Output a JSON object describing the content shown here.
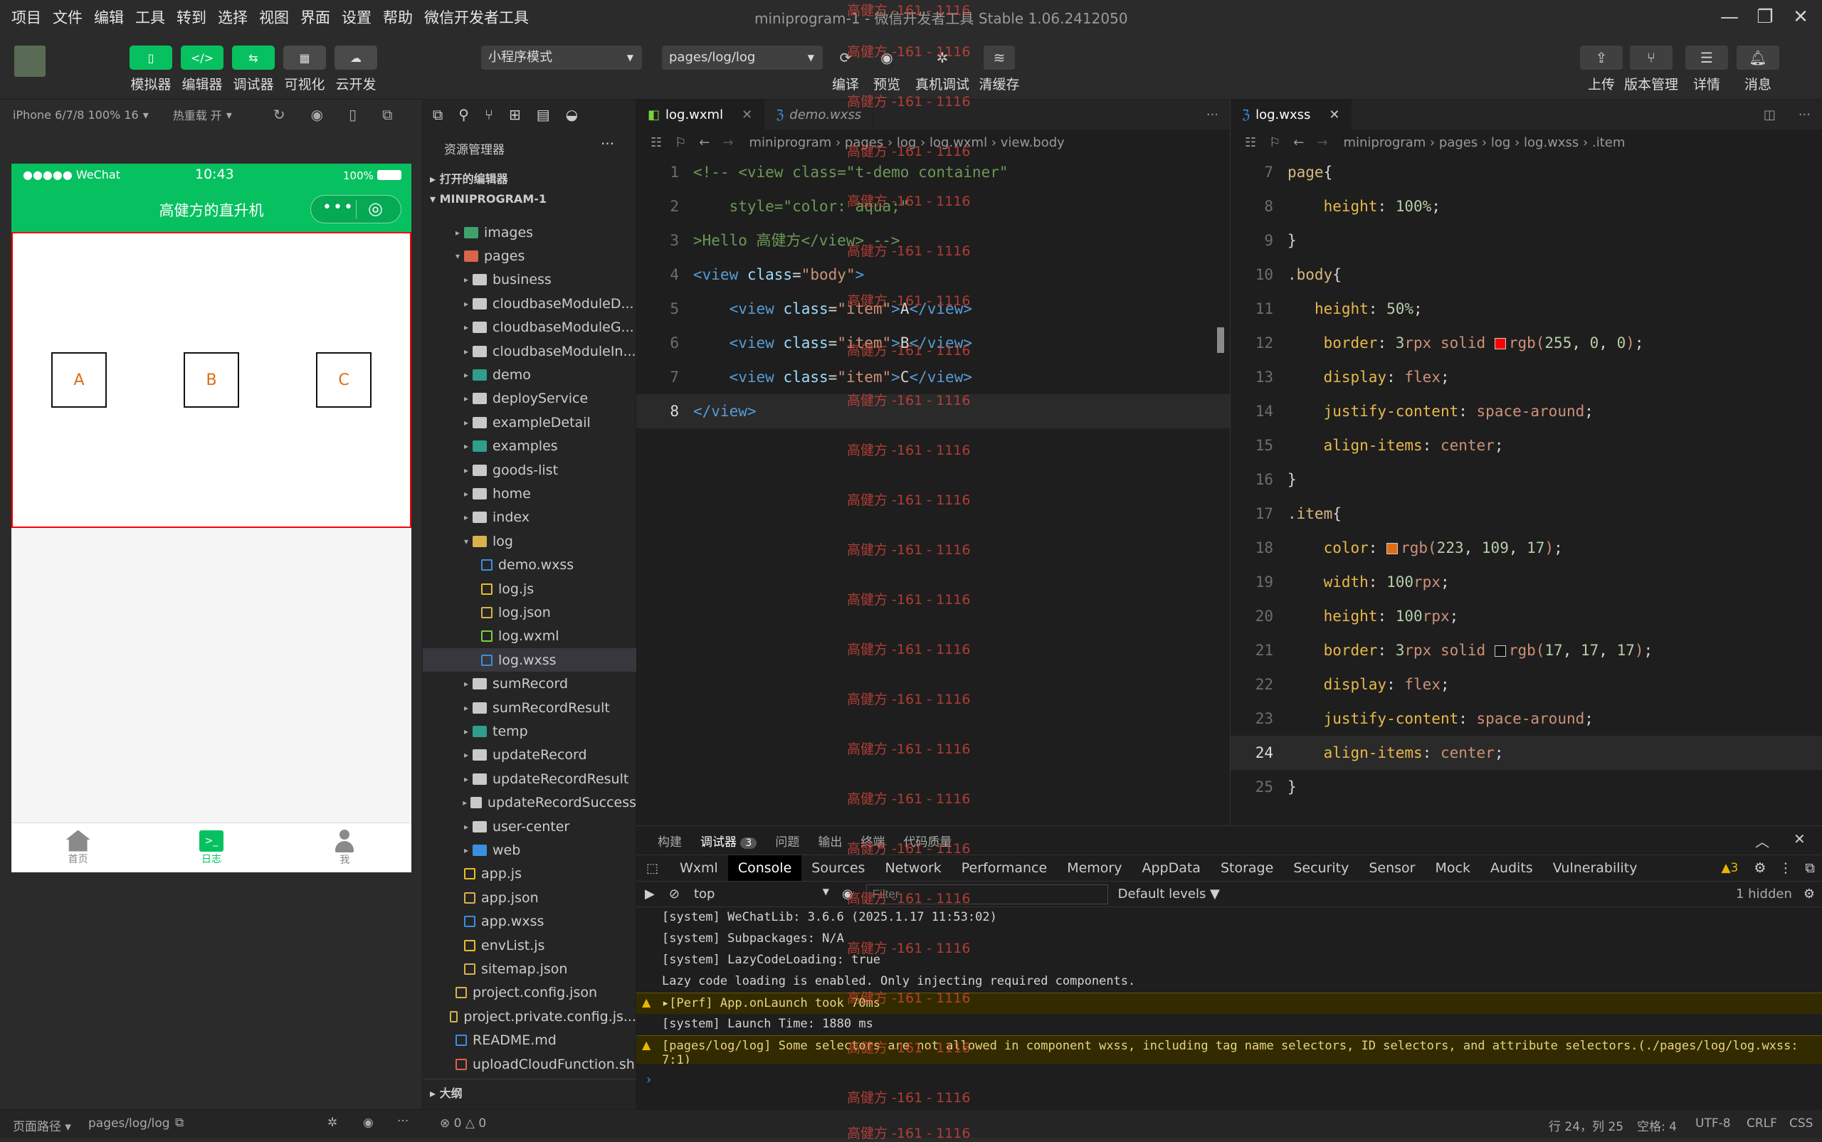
{
  "menubar": {
    "items": [
      "项目",
      "文件",
      "编辑",
      "工具",
      "转到",
      "选择",
      "视图",
      "界面",
      "设置",
      "帮助",
      "微信开发者工具"
    ],
    "title": "miniprogram-1 - 微信开发者工具 Stable 1.06.2412050"
  },
  "toolbar": {
    "simulator": "模拟器",
    "editor": "编辑器",
    "debugger": "调试器",
    "visual": "可视化",
    "cloud": "云开发",
    "mode": "小程序模式",
    "page_path": "pages/log/log",
    "compile": "编译",
    "preview": "预览",
    "real_debug": "真机调试",
    "clear_cache": "清缓存",
    "upload": "上传",
    "version": "版本管理",
    "details": "详情",
    "messages": "消息"
  },
  "simulator": {
    "device": "iPhone 6/7/8 100% 16",
    "hot_reload": "热重载 开",
    "status_carrier": "●●●●● WeChat",
    "status_time": "10:43",
    "status_battery": "100%",
    "nav_title": "高健方的直升机",
    "items": [
      "A",
      "B",
      "C"
    ],
    "tabs": [
      {
        "label": "首页",
        "icon": "home-icon"
      },
      {
        "label": "日志",
        "icon": "terminal-icon"
      },
      {
        "label": "我",
        "icon": "user-icon"
      }
    ]
  },
  "explorer": {
    "title": "资源管理器",
    "open_editors": "打开的编辑器",
    "project": "MINIPROGRAM-1",
    "outline": "大纲",
    "tree": [
      {
        "label": "images",
        "type": "folder-green",
        "depth": 1,
        "chev": "▸"
      },
      {
        "label": "pages",
        "type": "folder-red",
        "depth": 1,
        "chev": "▾"
      },
      {
        "label": "business",
        "type": "folder",
        "depth": 2,
        "chev": "▸"
      },
      {
        "label": "cloudbaseModuleD...",
        "type": "folder",
        "depth": 2,
        "chev": "▸"
      },
      {
        "label": "cloudbaseModuleG...",
        "type": "folder",
        "depth": 2,
        "chev": "▸"
      },
      {
        "label": "cloudbaseModuleIn...",
        "type": "folder",
        "depth": 2,
        "chev": "▸"
      },
      {
        "label": "demo",
        "type": "folder-teal",
        "depth": 2,
        "chev": "▸"
      },
      {
        "label": "deployService",
        "type": "folder",
        "depth": 2,
        "chev": "▸"
      },
      {
        "label": "exampleDetail",
        "type": "folder",
        "depth": 2,
        "chev": "▸"
      },
      {
        "label": "examples",
        "type": "folder-teal",
        "depth": 2,
        "chev": "▸"
      },
      {
        "label": "goods-list",
        "type": "folder",
        "depth": 2,
        "chev": "▸"
      },
      {
        "label": "home",
        "type": "folder",
        "depth": 2,
        "chev": "▸"
      },
      {
        "label": "index",
        "type": "folder",
        "depth": 2,
        "chev": "▸"
      },
      {
        "label": "log",
        "type": "folder-yellow",
        "depth": 2,
        "chev": "▾"
      },
      {
        "label": "demo.wxss",
        "type": "wxss",
        "depth": 3,
        "chev": ""
      },
      {
        "label": "log.js",
        "type": "js",
        "depth": 3,
        "chev": ""
      },
      {
        "label": "log.json",
        "type": "json",
        "depth": 3,
        "chev": ""
      },
      {
        "label": "log.wxml",
        "type": "wxml",
        "depth": 3,
        "chev": ""
      },
      {
        "label": "log.wxss",
        "type": "wxss",
        "depth": 3,
        "chev": "",
        "selected": true
      },
      {
        "label": "sumRecord",
        "type": "folder",
        "depth": 2,
        "chev": "▸"
      },
      {
        "label": "sumRecordResult",
        "type": "folder",
        "depth": 2,
        "chev": "▸"
      },
      {
        "label": "temp",
        "type": "folder-teal",
        "depth": 2,
        "chev": "▸"
      },
      {
        "label": "updateRecord",
        "type": "folder",
        "depth": 2,
        "chev": "▸"
      },
      {
        "label": "updateRecordResult",
        "type": "folder",
        "depth": 2,
        "chev": "▸"
      },
      {
        "label": "updateRecordSuccess",
        "type": "folder",
        "depth": 2,
        "chev": "▸"
      },
      {
        "label": "user-center",
        "type": "folder",
        "depth": 2,
        "chev": "▸"
      },
      {
        "label": "web",
        "type": "folder-blue",
        "depth": 2,
        "chev": "▸"
      },
      {
        "label": "app.js",
        "type": "js",
        "depth": 1,
        "chev": ""
      },
      {
        "label": "app.json",
        "type": "json",
        "depth": 1,
        "chev": ""
      },
      {
        "label": "app.wxss",
        "type": "wxss",
        "depth": 1,
        "chev": ""
      },
      {
        "label": "envList.js",
        "type": "js",
        "depth": 1,
        "chev": ""
      },
      {
        "label": "sitemap.json",
        "type": "json",
        "depth": 1,
        "chev": ""
      },
      {
        "label": "project.config.json",
        "type": "json",
        "depth": 0,
        "chev": ""
      },
      {
        "label": "project.private.config.js...",
        "type": "json",
        "depth": 0,
        "chev": ""
      },
      {
        "label": "README.md",
        "type": "info",
        "depth": 0,
        "chev": ""
      },
      {
        "label": "uploadCloudFunction.sh",
        "type": "sh",
        "depth": 0,
        "chev": ""
      }
    ]
  },
  "editor1": {
    "tabs": [
      "log.wxml",
      "demo.wxss"
    ],
    "crumbs": [
      "miniprogram",
      "pages",
      "log",
      "log.wxml",
      "view.body"
    ],
    "lines": [
      [
        [
          "c-com",
          "<!-- <view class=\"t-demo container\""
        ]
      ],
      [
        [
          "c-com",
          "    style=\"color: aqua;\""
        ]
      ],
      [
        [
          "c-com",
          ">Hello 高健方</view> -->"
        ]
      ],
      [
        [
          "c-tag",
          "<view "
        ],
        [
          "c-attr",
          "class"
        ],
        [
          "c-punc",
          "="
        ],
        [
          "c-str",
          "\"body\""
        ],
        [
          "c-tag",
          ">"
        ]
      ],
      [
        [
          "c-txt",
          "    "
        ],
        [
          "c-tag",
          "<view "
        ],
        [
          "c-attr",
          "class"
        ],
        [
          "c-punc",
          "="
        ],
        [
          "c-str",
          "\"item\""
        ],
        [
          "c-tag",
          ">"
        ],
        [
          "c-txt",
          "A"
        ],
        [
          "c-tag",
          "</view>"
        ]
      ],
      [
        [
          "c-txt",
          "    "
        ],
        [
          "c-tag",
          "<view "
        ],
        [
          "c-attr",
          "class"
        ],
        [
          "c-punc",
          "="
        ],
        [
          "c-str",
          "\"item\""
        ],
        [
          "c-tag",
          ">"
        ],
        [
          "c-txt",
          "B"
        ],
        [
          "c-tag",
          "</view>"
        ]
      ],
      [
        [
          "c-txt",
          "    "
        ],
        [
          "c-tag",
          "<view "
        ],
        [
          "c-attr",
          "class"
        ],
        [
          "c-punc",
          "="
        ],
        [
          "c-str",
          "\"item\""
        ],
        [
          "c-tag",
          ">"
        ],
        [
          "c-txt",
          "C"
        ],
        [
          "c-tag",
          "</view>"
        ]
      ],
      [
        [
          "c-tag",
          "</view>"
        ]
      ]
    ],
    "current_line": 8
  },
  "editor2": {
    "tabs": [
      "log.wxss"
    ],
    "crumbs": [
      "miniprogram",
      "pages",
      "log",
      "log.wxss",
      ".item"
    ],
    "first_line": 7,
    "lines": [
      [
        [
          "c-sel",
          "page"
        ],
        [
          "c-punc",
          "{"
        ]
      ],
      [
        [
          "c-txt",
          "    "
        ],
        [
          "c-prop",
          "height"
        ],
        [
          "c-punc",
          ": "
        ],
        [
          "c-num",
          "100%"
        ],
        [
          "c-punc",
          ";"
        ]
      ],
      [
        [
          "c-punc",
          "}"
        ]
      ],
      [
        [
          "c-sel",
          ".body"
        ],
        [
          "c-punc",
          "{"
        ]
      ],
      [
        [
          "c-txt",
          "   "
        ],
        [
          "c-prop",
          "height"
        ],
        [
          "c-punc",
          ": "
        ],
        [
          "c-num",
          "50%"
        ],
        [
          "c-punc",
          ";"
        ]
      ],
      [
        [
          "c-txt",
          "    "
        ],
        [
          "c-prop",
          "border"
        ],
        [
          "c-punc",
          ": "
        ],
        [
          "c-num",
          "3"
        ],
        [
          "c-val",
          "rpx solid "
        ],
        [
          "swatch",
          "#ff0000"
        ],
        [
          "c-val",
          "rgb("
        ],
        [
          "c-num",
          "255"
        ],
        [
          "c-punc",
          ", "
        ],
        [
          "c-num",
          "0"
        ],
        [
          "c-punc",
          ", "
        ],
        [
          "c-num",
          "0"
        ],
        [
          "c-val",
          ")"
        ],
        [
          "c-punc",
          ";"
        ]
      ],
      [
        [
          "c-txt",
          "    "
        ],
        [
          "c-prop",
          "display"
        ],
        [
          "c-punc",
          ": "
        ],
        [
          "c-val",
          "flex"
        ],
        [
          "c-punc",
          ";"
        ]
      ],
      [
        [
          "c-txt",
          "    "
        ],
        [
          "c-prop",
          "justify-content"
        ],
        [
          "c-punc",
          ": "
        ],
        [
          "c-val",
          "space-around"
        ],
        [
          "c-punc",
          ";"
        ]
      ],
      [
        [
          "c-txt",
          "    "
        ],
        [
          "c-prop",
          "align-items"
        ],
        [
          "c-punc",
          ": "
        ],
        [
          "c-val",
          "center"
        ],
        [
          "c-punc",
          ";"
        ]
      ],
      [
        [
          "c-punc",
          "}"
        ]
      ],
      [
        [
          "c-sel",
          ".item"
        ],
        [
          "c-punc",
          "{"
        ]
      ],
      [
        [
          "c-txt",
          "    "
        ],
        [
          "c-prop",
          "color"
        ],
        [
          "c-punc",
          ": "
        ],
        [
          "swatch",
          "#df6d11"
        ],
        [
          "c-val",
          "rgb("
        ],
        [
          "c-num",
          "223"
        ],
        [
          "c-punc",
          ", "
        ],
        [
          "c-num",
          "109"
        ],
        [
          "c-punc",
          ", "
        ],
        [
          "c-num",
          "17"
        ],
        [
          "c-val",
          ")"
        ],
        [
          "c-punc",
          ";"
        ]
      ],
      [
        [
          "c-txt",
          "    "
        ],
        [
          "c-prop",
          "width"
        ],
        [
          "c-punc",
          ": "
        ],
        [
          "c-num",
          "100"
        ],
        [
          "c-val",
          "rpx"
        ],
        [
          "c-punc",
          ";"
        ]
      ],
      [
        [
          "c-txt",
          "    "
        ],
        [
          "c-prop",
          "height"
        ],
        [
          "c-punc",
          ": "
        ],
        [
          "c-num",
          "100"
        ],
        [
          "c-val",
          "rpx"
        ],
        [
          "c-punc",
          ";"
        ]
      ],
      [
        [
          "c-txt",
          "    "
        ],
        [
          "c-prop",
          "border"
        ],
        [
          "c-punc",
          ": "
        ],
        [
          "c-num",
          "3"
        ],
        [
          "c-val",
          "rpx solid "
        ],
        [
          "swatch",
          "#111111"
        ],
        [
          "c-val",
          "rgb("
        ],
        [
          "c-num",
          "17"
        ],
        [
          "c-punc",
          ", "
        ],
        [
          "c-num",
          "17"
        ],
        [
          "c-punc",
          ", "
        ],
        [
          "c-num",
          "17"
        ],
        [
          "c-val",
          ")"
        ],
        [
          "c-punc",
          ";"
        ]
      ],
      [
        [
          "c-txt",
          "    "
        ],
        [
          "c-prop",
          "display"
        ],
        [
          "c-punc",
          ": "
        ],
        [
          "c-val",
          "flex"
        ],
        [
          "c-punc",
          ";"
        ]
      ],
      [
        [
          "c-txt",
          "    "
        ],
        [
          "c-prop",
          "justify-content"
        ],
        [
          "c-punc",
          ": "
        ],
        [
          "c-val",
          "space-around"
        ],
        [
          "c-punc",
          ";"
        ]
      ],
      [
        [
          "c-txt",
          "    "
        ],
        [
          "c-prop",
          "align-items"
        ],
        [
          "c-punc",
          ": "
        ],
        [
          "c-val",
          "center"
        ],
        [
          "c-punc",
          ";"
        ]
      ],
      [
        [
          "c-punc",
          "}"
        ]
      ]
    ],
    "current_line": 24
  },
  "devtools": {
    "top_tabs": [
      "构建",
      "调试器",
      "问题",
      "输出",
      "终端",
      "代码质量"
    ],
    "debugger_badge": "3",
    "sub_tabs": [
      "Wxml",
      "Console",
      "Sources",
      "Network",
      "Performance",
      "Memory",
      "AppData",
      "Storage",
      "Security",
      "Sensor",
      "Mock",
      "Audits",
      "Vulnerability"
    ],
    "warn_count": "3",
    "context": "top",
    "filter_placeholder": "Filter",
    "levels": "Default levels",
    "hidden": "1 hidden",
    "logs": [
      {
        "text": "[system] WeChatLib: 3.6.6 (2025.1.17 11:53:02)",
        "level": "info"
      },
      {
        "text": "[system] Subpackages: N/A",
        "level": "info"
      },
      {
        "text": "[system] LazyCodeLoading: true",
        "level": "info"
      },
      {
        "text": "Lazy code loading is enabled. Only injecting required components.",
        "level": "info"
      },
      {
        "text": "▸[Perf] App.onLaunch took 70ms",
        "level": "warn"
      },
      {
        "text": "[system] Launch Time: 1880 ms",
        "level": "info"
      },
      {
        "text": "[pages/log/log] Some selectors are not allowed in component wxss, including tag name selectors, ID selectors, and attribute selectors.(./pages/log/log.wxss:\n7:1)",
        "level": "warn"
      }
    ]
  },
  "statusbar": {
    "page_path_label": "页面路径",
    "page_path": "pages/log/log",
    "problems": "⊗ 0 △ 0",
    "cursor": "行 24，列 25",
    "spaces": "空格: 4",
    "encoding": "UTF-8",
    "eol": "CRLF",
    "language": "CSS"
  },
  "watermark": "高健方 -161 - 1116",
  "colors": {
    "accent": "#07c160",
    "item_color": "#df6d11",
    "border_red": "#ff0000"
  }
}
